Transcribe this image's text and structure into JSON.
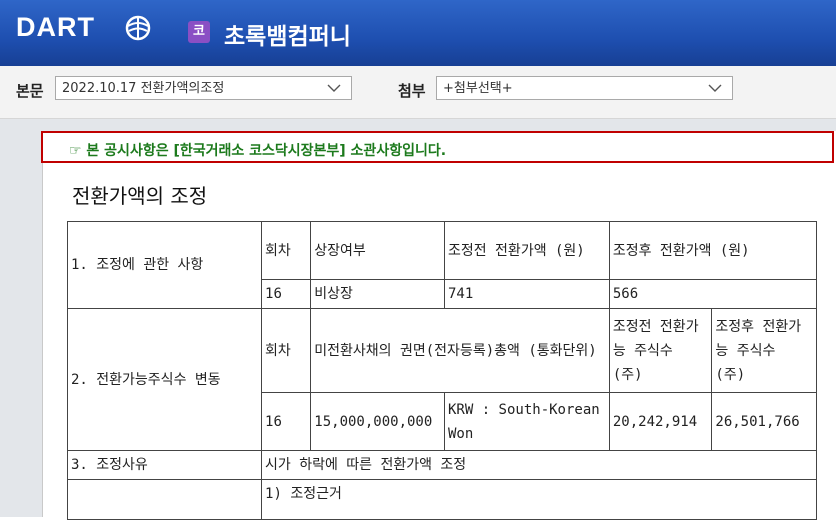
{
  "header": {
    "logo": "DART",
    "company_badge": "코",
    "company_name": "초록뱀컴퍼니"
  },
  "toolbar": {
    "body_label": "본문",
    "body_selected": "2022.10.17  전환가액의조정",
    "attach_label": "첨부",
    "attach_selected": "+첨부선택+"
  },
  "notice": {
    "text": "☞ 본 공시사항은 [한국거래소 코스닥시장본부] 소관사항입니다."
  },
  "document": {
    "title": "전환가액의 조정",
    "s1": {
      "label": "1. 조정에 관한 사항",
      "h_round": "회차",
      "h_listed": "상장여부",
      "h_before": "조정전 전환가액 (원)",
      "h_after": "조정후 전환가액 (원)",
      "round": "16",
      "listed": "비상장",
      "before": "741",
      "after": "566"
    },
    "s2": {
      "label": "2. 전환가능주식수 변동",
      "h_round": "회차",
      "h_amount": "미전환사채의 권면(전자등록)총액 (통화단위)",
      "h_before": "조정전 전환가능 주식수 (주)",
      "h_after": "조정후 전환가능 주식수 (주)",
      "round": "16",
      "amount": "15,000,000,000",
      "currency": "KRW : South-Korean Won",
      "before": "20,242,914",
      "after": "26,501,766"
    },
    "s3": {
      "label": "3. 조정사유",
      "value": "시가 하락에 따른 전환가액 조정"
    },
    "s4": {
      "value": "1) 조정근거"
    }
  }
}
